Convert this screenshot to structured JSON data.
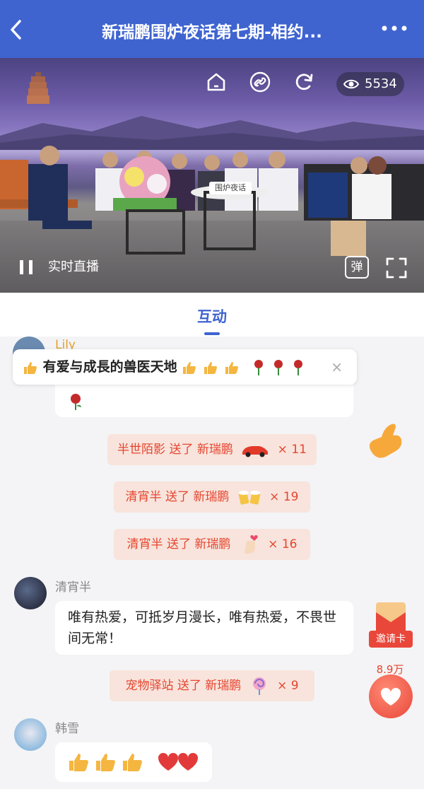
{
  "header": {
    "title": "新瑞鹏围炉夜话第七期-相约...",
    "back_icon": "chevron-left-icon",
    "more_icon": "ellipsis-icon",
    "background": "#3f64d0"
  },
  "video": {
    "view_count": "5534",
    "live_label": "实时直播",
    "danmu_label": "弹",
    "table_sign": "围炉夜话",
    "icons": [
      "home-icon",
      "link-icon",
      "refresh-icon",
      "eye-icon",
      "pause-icon",
      "fullscreen-icon"
    ]
  },
  "tabs": {
    "active": "互动"
  },
  "feed": {
    "toast": {
      "text": "有爱与成長的兽医天地",
      "icon": "thumbs-up-icon",
      "close": "×"
    },
    "first_message": {
      "user": "Lily",
      "text_tail": "有爱与成長的兽医天地"
    },
    "gifts": [
      {
        "text": "半世陌影 送了 新瑞鹏",
        "count": "× 11",
        "gift_icon": "sports-car-icon"
      },
      {
        "text": "清宵半 送了 新瑞鹏",
        "count": "× 19",
        "gift_icon": "cheers-beer-icon"
      },
      {
        "text": "清宵半 送了 新瑞鹏",
        "count": "× 16",
        "gift_icon": "finger-heart-icon"
      },
      {
        "text": "宠物驿站 送了 新瑞鹏",
        "count": "× 9",
        "gift_icon": "lollipop-icon"
      }
    ],
    "messages": [
      {
        "user": "清宵半",
        "text": "唯有热爱，可抵岁月漫长，唯有热爱，不畏世间无常！"
      },
      {
        "user": "韩雪",
        "text": ""
      }
    ]
  },
  "side": {
    "invite_label": "邀请卡",
    "like_count": "8.9万",
    "accent": "#e9473a"
  }
}
